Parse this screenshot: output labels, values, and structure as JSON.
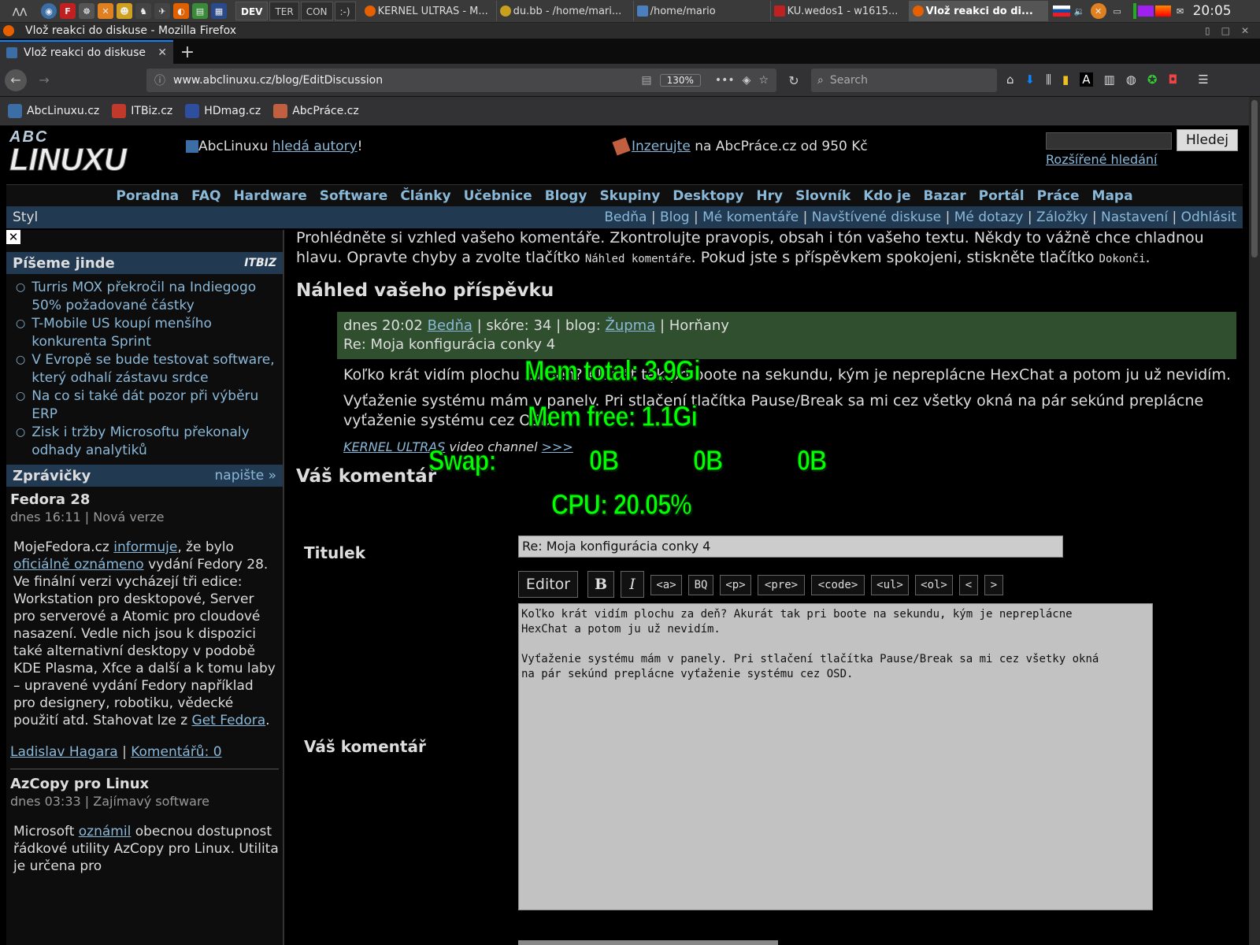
{
  "panel": {
    "ws_buttons": [
      "DEV",
      "TER",
      "CON",
      ":-)"
    ],
    "tasks": [
      {
        "label": "KERNEL ULTRAS - M...",
        "color": "#e66000"
      },
      {
        "label": "du.bb - /home/mari...",
        "color": "#c8a020"
      },
      {
        "label": "/home/mario",
        "color": "#4a80c0"
      },
      {
        "label": "KU.wedos1 - w1615...",
        "color": "#c02020"
      },
      {
        "label": "Vlož reakci do di...",
        "color": "#e66000"
      }
    ],
    "clock": "20:05"
  },
  "window": {
    "title": "Vlož reakci do diskuse - Mozilla Firefox"
  },
  "browser": {
    "tab_title": "Vlož reakci do diskuse",
    "url": "www.abclinuxu.cz/blog/EditDiscussion",
    "zoom": "130%",
    "search_placeholder": "Search",
    "bookmarks": [
      {
        "label": "AbcLinuxu.cz",
        "color": "#3a6ea5"
      },
      {
        "label": "ITBiz.cz",
        "color": "#c0392b"
      },
      {
        "label": "HDmag.cz",
        "color": "#2e4e9e"
      },
      {
        "label": "AbcPráce.cz",
        "color": "#c06040"
      }
    ]
  },
  "site": {
    "logo_top": "ABC",
    "logo_bottom": "LINUXU",
    "promo1_pre": "AbcLinuxu ",
    "promo1_link": "hledá autory",
    "promo1_post": "!",
    "promo2_link": "Inzerujte",
    "promo2_post": " na AbcPráce.cz od 950 Kč",
    "search_button": "Hledej",
    "advanced_search": "Rozšířené hledání",
    "menu": [
      "Poradna",
      "FAQ",
      "Hardware",
      "Software",
      "Články",
      "Učebnice",
      "Blogy",
      "Skupiny",
      "Desktopy",
      "Hry",
      "Slovník",
      "Kdo je",
      "Bazar",
      "Portál",
      "Práce",
      "Mapa"
    ],
    "style_label": "Styl",
    "user_menu": [
      "Bedňa",
      "Blog",
      "Mé komentáře",
      "Navštívené diskuse",
      "Mé dotazy",
      "Záložky",
      "Nastavení",
      "Odhlásit"
    ]
  },
  "sidebar": {
    "close": "✕",
    "section1_title": "Píšeme jinde",
    "section1_badge": "ITBIZ",
    "articles": [
      "Turris MOX překročil na Indiegogo 50% požadované částky",
      "T-Mobile US koupí menšího konkurenta Sprint",
      "V Evropě se bude testovat software, který odhalí zástavu srdce",
      "Na co si také dát pozor při výběru ERP",
      "Zisk i tržby Microsoftu překonaly odhady analytiků"
    ],
    "section2_title": "Zprávičky",
    "section2_action": "napište »",
    "news": [
      {
        "title": "Fedora 28",
        "meta": "dnes 16:11 | Nová verze",
        "p1": "MojeFedora.cz ",
        "l1": "informuje",
        "p2": ", že bylo ",
        "l2": "oficiálně oznámeno",
        "p3": " vydání Fedory 28. Ve finální verzi vycházejí tři edice: Workstation pro desktopové, Server pro serverové a Atomic pro cloudové nasazení. Vedle nich jsou k dispozici také alternativní desktopy v podobě KDE Plasma, Xfce a další a k tomu laby – upravené vydání Fedory například pro designery, robotiku, vědecké použití atd. Stahovat lze z ",
        "l3": "Get Fedora",
        "p4": ".",
        "author": "Ladislav Hagara",
        "comments": "Komentářů: 0"
      },
      {
        "title": "AzCopy pro Linux",
        "meta": "dnes 03:33 | Zajímavý software",
        "p1": "Microsoft ",
        "l1": "oznámil",
        "p2": " obecnou dostupnost řádkové utility AzCopy pro Linux. Utilita je určena pro"
      }
    ]
  },
  "main": {
    "intro_1": "Prohlédněte si vzhled vašeho komentáře. Zkontrolujte pravopis, obsah i tón vašeho textu. Někdy to vážně chce chladnou hlavu. Opravte chyby a zvolte tlačítko ",
    "intro_code1": "Náhled komentáře",
    "intro_2": ". Pokud jste s příspěvkem spokojeni, stiskněte tlačítko ",
    "intro_code2": "Dokonči",
    "intro_3": ".",
    "preview_heading": "Náhled vašeho příspěvku",
    "preview_meta_pre": "dnes 20:02 ",
    "preview_author": "Bedňa",
    "preview_meta_mid": " | skóre: 34 | blog: ",
    "preview_blog": "Župma",
    "preview_meta_post": " | Horňany",
    "preview_subject": "Re: Moja konfigurácia conky 4",
    "preview_p1": "Koľko krát vidím plochu za deň? Akurát tak pri boote na sekundu, kým je nepreplácne HexChat a potom ju už nevidím.",
    "preview_p2": "Vyťaženie systému mám v panely. Pri stlačení tlačítka Pause/Break sa mi cez všetky okná na pár sekúnd preplácne vyťaženie systému cez OSD.",
    "signature_link": "KERNEL ULTRAS",
    "signature_text": " video channel ",
    "signature_more": ">>>",
    "form_heading": "Váš komentář",
    "title_label": "Titulek",
    "title_value": "Re: Moja konfigurácia conky 4",
    "comment_label": "Váš komentář",
    "editor_label": "Editor",
    "toolbar": [
      "B",
      "I",
      "<a>",
      "BQ",
      "<p>",
      "<pre>",
      "<code>",
      "<ul>",
      "<ol>",
      "<",
      ">"
    ],
    "comment_text": "Koľko krát vidím plochu za deň? Akurát tak pri boote na sekundu, kým je nepreplácne\nHexChat a potom ju už nevidím.\n\nVyťaženie systému mám v panely. Pri stlačení tlačítka Pause/Break sa mi cez všetky okná\nna pár sekúnd preplácne vyťaženie systému cez OSD."
  },
  "conky": {
    "mem_total": "Mem total:   3.9Gi",
    "mem_free": "Mem free:   1.1Gi",
    "swap_label": "Swap:",
    "swap_v1": "0B",
    "swap_v2": "0B",
    "swap_v3": "0B",
    "cpu": "CPU: 20.05%"
  }
}
